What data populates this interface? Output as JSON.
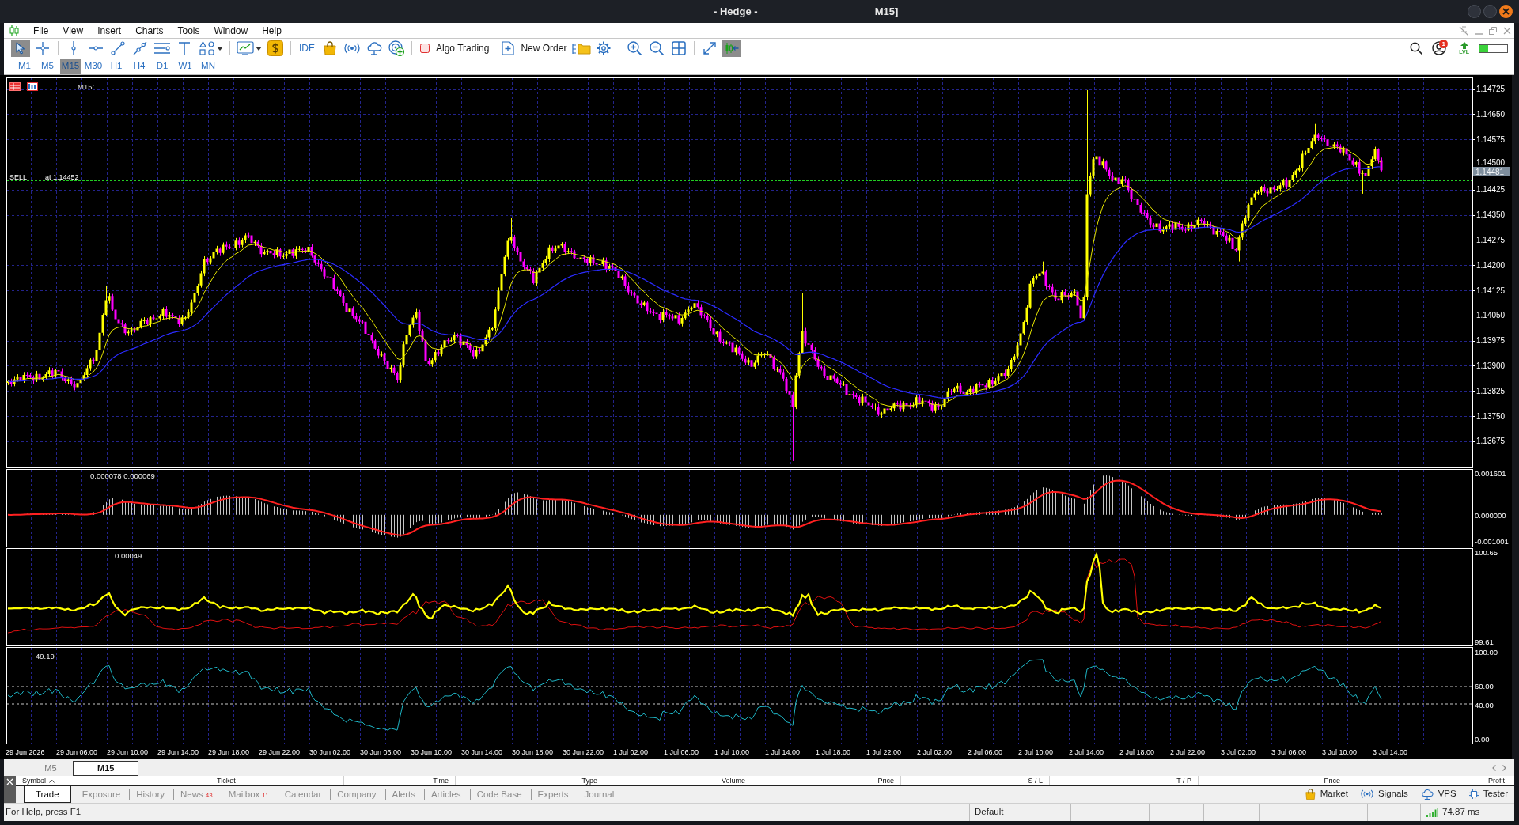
{
  "window": {
    "title": "- Hedge -",
    "title_suffix": "M15]"
  },
  "menu": [
    "File",
    "View",
    "Insert",
    "Charts",
    "Tools",
    "Window",
    "Help"
  ],
  "toolbar": {
    "cursor_modes": [
      {
        "selected": true
      },
      {
        "selected": false
      }
    ],
    "ide_label": "IDE",
    "algo_trading": {
      "label": "Algo Trading",
      "on": false
    },
    "new_order_label": "New Order",
    "chart_shift": {
      "on": true
    },
    "notifications_badge": "1",
    "level_label": "LVL",
    "meter": {
      "level": 0.3
    }
  },
  "timeframes": [
    {
      "label": "M1",
      "selected": false
    },
    {
      "label": "M5",
      "selected": false
    },
    {
      "label": "M15",
      "selected": true
    },
    {
      "label": "M30",
      "selected": false
    },
    {
      "label": "H1",
      "selected": false
    },
    {
      "label": "H4",
      "selected": false
    },
    {
      "label": "D1",
      "selected": false
    },
    {
      "label": "W1",
      "selected": false
    },
    {
      "label": "MN",
      "selected": false
    }
  ],
  "chart": {
    "timeframe_label": "M15:",
    "order_line": {
      "side": "SELL",
      "price_text": "at 1.14452"
    },
    "current_price": "1.14481",
    "price_axis": [
      "1.14725",
      "1.14650",
      "1.14575",
      "1.14500",
      "1.14425",
      "1.14350",
      "1.14275",
      "1.14200",
      "1.14125",
      "1.14050",
      "1.13975",
      "1.13900",
      "1.13825",
      "1.13750",
      "1.13675"
    ],
    "time_axis": [
      "29 Jun 2026",
      "29 Jun 06:00",
      "29 Jun 10:00",
      "29 Jun 14:00",
      "29 Jun 18:00",
      "29 Jun 22:00",
      "30 Jun 02:00",
      "30 Jun 06:00",
      "30 Jun 10:00",
      "30 Jun 14:00",
      "30 Jun 18:00",
      "30 Jun 22:00",
      "1 Jul 02:00",
      "1 Jul 06:00",
      "1 Jul 10:00",
      "1 Jul 14:00",
      "1 Jul 18:00",
      "1 Jul 22:00",
      "2 Jul 02:00",
      "2 Jul 06:00",
      "2 Jul 10:00",
      "2 Jul 14:00",
      "2 Jul 18:00",
      "2 Jul 22:00",
      "3 Jul 02:00",
      "3 Jul 06:00",
      "3 Jul 10:00",
      "3 Jul 14:00"
    ],
    "indicators": [
      {
        "kind": "histogram",
        "value_text": "0.000078 0.000069",
        "axis_labels": [
          "0.001601",
          "0.000000",
          "-0.001001"
        ]
      },
      {
        "kind": "oscillator",
        "value_text": "0.00049",
        "axis_labels": [
          "100.65",
          "99.61"
        ]
      },
      {
        "kind": "rsi",
        "value_text": "49.19",
        "axis_labels": [
          "100.00",
          "60.00",
          "40.00",
          "0.00"
        ]
      }
    ]
  },
  "chart_tabs": [
    {
      "label": "M5",
      "selected": false
    },
    {
      "label": "M15",
      "selected": true
    }
  ],
  "toolbox": {
    "columns": [
      "Symbol",
      "Ticket",
      "Time",
      "Type",
      "Volume",
      "Price",
      "S / L",
      "T / P",
      "Price",
      "Profit"
    ],
    "tabs": [
      {
        "label": "Trade",
        "selected": true
      },
      {
        "label": "Exposure",
        "selected": false
      },
      {
        "label": "History",
        "selected": false
      },
      {
        "label": "News",
        "count": "43",
        "selected": false
      },
      {
        "label": "Mailbox",
        "count": "11",
        "selected": false
      },
      {
        "label": "Calendar",
        "selected": false
      },
      {
        "label": "Company",
        "selected": false
      },
      {
        "label": "Alerts",
        "selected": false
      },
      {
        "label": "Articles",
        "selected": false
      },
      {
        "label": "Code Base",
        "selected": false
      },
      {
        "label": "Experts",
        "selected": false
      },
      {
        "label": "Journal",
        "selected": false
      }
    ],
    "services": [
      "Market",
      "Signals",
      "VPS",
      "Tester"
    ]
  },
  "status_bar": {
    "help": "For Help, press F1",
    "profile": "Default",
    "ping": "74.87 ms"
  }
}
